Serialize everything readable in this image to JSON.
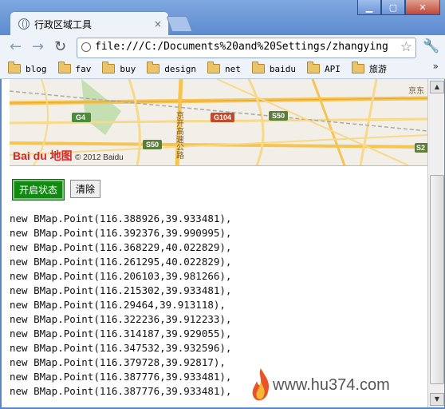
{
  "window": {
    "tab_title": "行政区域工具",
    "tab_close": "×",
    "minimize": "▁",
    "maximize": "▢",
    "close": "✕"
  },
  "toolbar": {
    "back": "←",
    "forward": "→",
    "reload": "↻",
    "url": "file:///C:/Documents%20and%20Settings/zhangying",
    "star": "☆",
    "wrench": "🔧"
  },
  "bookmarks": [
    "blog",
    "fav",
    "buy",
    "design",
    "net",
    "baidu",
    "API",
    "旅游"
  ],
  "bookmarks_more": "»",
  "map": {
    "copyright": "© 2012 Baidu",
    "logo": "Bai du 地图",
    "roads": [
      "G4",
      "G104",
      "S50",
      "S50",
      "S2"
    ],
    "place_labels": [
      "京开高速公路",
      "京东"
    ]
  },
  "controls": {
    "start_label": "开启状态",
    "clear_label": "清除"
  },
  "points": [
    "new BMap.Point(116.388926,39.933481),",
    "new BMap.Point(116.392376,39.990995),",
    "new BMap.Point(116.368229,40.022829),",
    "new BMap.Point(116.261295,40.022829),",
    "new BMap.Point(116.206103,39.981266),",
    "new BMap.Point(116.215302,39.933481),",
    "new BMap.Point(116.29464,39.913118),",
    "new BMap.Point(116.322236,39.912233),",
    "new BMap.Point(116.314187,39.929055),",
    "new BMap.Point(116.347532,39.932596),",
    "new BMap.Point(116.379728,39.92817),",
    "new BMap.Point(116.387776,39.933481),",
    "new BMap.Point(116.387776,39.933481),"
  ],
  "watermark": "www.hu374.com"
}
